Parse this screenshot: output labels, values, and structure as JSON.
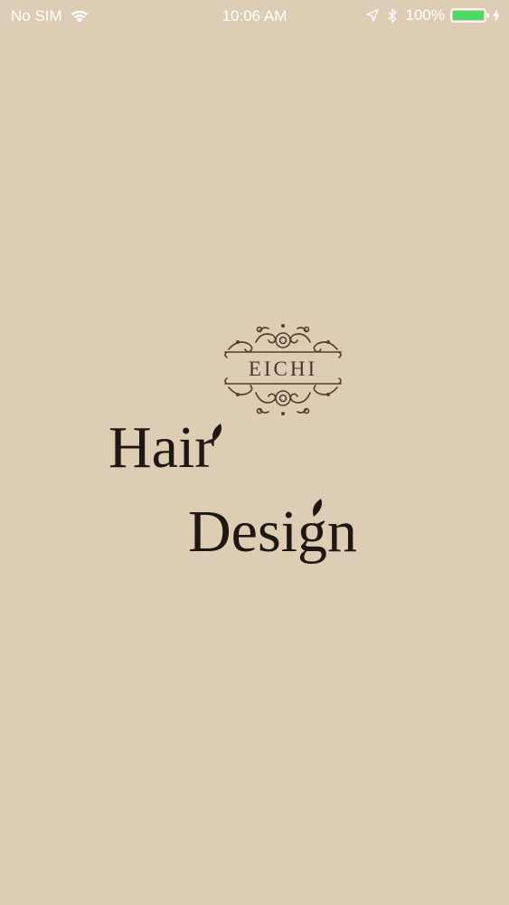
{
  "status_bar": {
    "carrier": "No SIM",
    "time": "10:06 AM",
    "battery": "100%",
    "icons": [
      "wifi-icon",
      "location-icon",
      "bluetooth-icon",
      "battery-icon",
      "charging-icon"
    ],
    "battery_color": "#4cd964"
  },
  "logo": {
    "brand": "EICHI",
    "line1": "Hair",
    "line2": "Design",
    "brand_color": "#4a3528",
    "text_color": "#1e1712"
  },
  "background_color": "#ddcdb5"
}
